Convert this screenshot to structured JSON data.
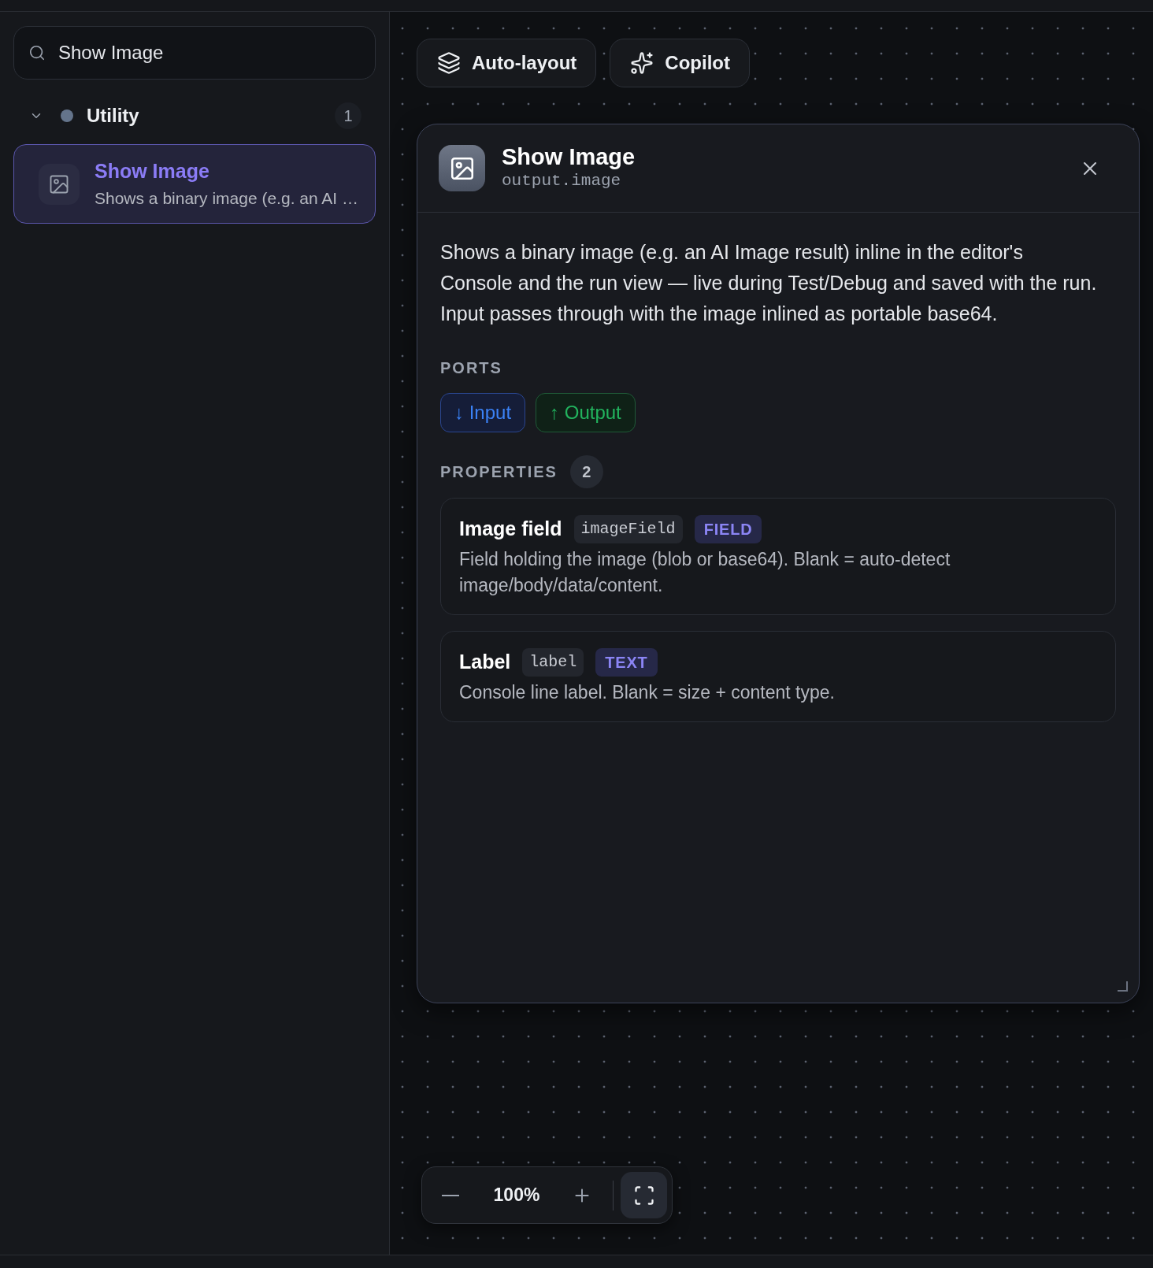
{
  "search": {
    "value": "Show Image"
  },
  "categories": [
    {
      "label": "Utility",
      "expanded": true,
      "color": "#64748b",
      "count": "1",
      "children": [
        {
          "title": "Show Image",
          "description": "Shows a binary image (e.g. an AI …",
          "selected": true
        }
      ]
    }
  ],
  "toolbar": [
    {
      "label": "Auto-layout"
    },
    {
      "label": "Copilot"
    }
  ],
  "panel": {
    "title": "Show Image",
    "type": "output.image",
    "description": "Shows a binary image (e.g. an AI Image result) inline in the editor's Console and the run view — live during Test/Debug and saved with the run. Input passes through with the image inlined as portable base64.",
    "ports_heading": "PORTS",
    "ports": [
      {
        "label": "↓ Input",
        "kind": "input"
      },
      {
        "label": "↑ Output",
        "kind": "output"
      }
    ],
    "properties_heading": "PROPERTIES",
    "properties_count": "2",
    "properties": [
      {
        "name": "Image field",
        "key": "imageField",
        "type": "FIELD",
        "description": "Field holding the image (blob or base64). Blank = auto-detect image/body/data/content."
      },
      {
        "name": "Label",
        "key": "label",
        "type": "TEXT",
        "description": "Console line label. Blank = size + content type."
      }
    ]
  },
  "zoom": {
    "value": "100%"
  }
}
